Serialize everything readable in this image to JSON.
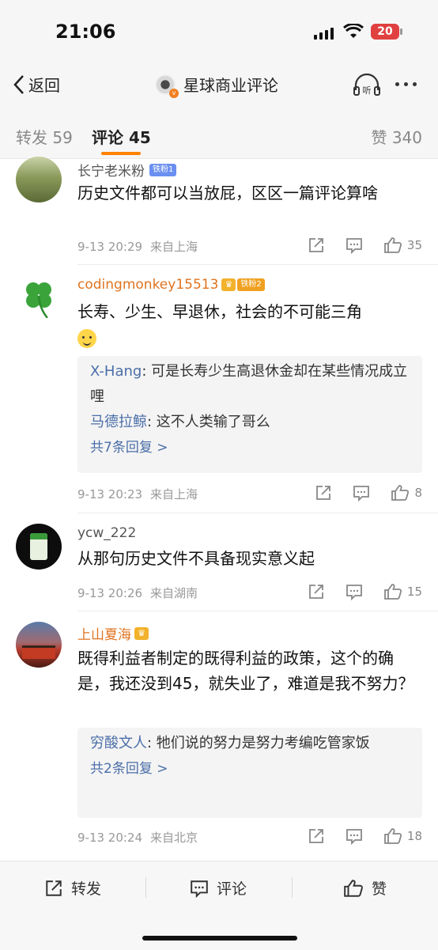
{
  "status": {
    "time": "21:06",
    "battery": "20"
  },
  "nav": {
    "back_label": "返回",
    "title": "星球商业评论",
    "listen_label": "听"
  },
  "tabs": {
    "repost": "转发 59",
    "comment": "评论 45",
    "like": "赞 340"
  },
  "comments": [
    {
      "name": "长宁老米粉",
      "badge": "铁粉1",
      "text": "历史文件都可以当放屁，区区一篇评论算啥",
      "time": "9-13 20:29",
      "location": "来自上海",
      "likes": "35"
    },
    {
      "name": "codingmonkey15513",
      "badge": "铁粉2",
      "text": "长寿、少生、早退休，社会的不可能三角",
      "replies": [
        {
          "name": "X-Hang",
          "text": ": 可是长寿少生高退休金却在某些情况成立哩"
        },
        {
          "name": "马德拉鲸",
          "text": ": 这不人类输了哥么"
        }
      ],
      "more_replies": "共7条回复 >",
      "time": "9-13 20:23",
      "location": "来自上海",
      "likes": "8"
    },
    {
      "name": "ycw_222",
      "text": "从那句历史文件不具备现实意义起",
      "time": "9-13 20:26",
      "location": "来自湖南",
      "likes": "15"
    },
    {
      "name": "上山夏海",
      "text": "既得利益者制定的既得利益的政策，这个的确是，我还没到45，就失业了，难道是我不努力？",
      "replies": [
        {
          "name": "穷酸文人",
          "text": ": 牠们说的努力是努力考编吃管家饭"
        }
      ],
      "more_replies": "共2条回复 >",
      "time": "9-13 20:24",
      "location": "来自北京",
      "likes": "18"
    }
  ],
  "bottom": {
    "repost": "转发",
    "comment": "评论",
    "like": "赞"
  },
  "colors": {
    "accent": "#ff8200",
    "link": "#4a6ea8",
    "name_orange": "#e07420"
  }
}
